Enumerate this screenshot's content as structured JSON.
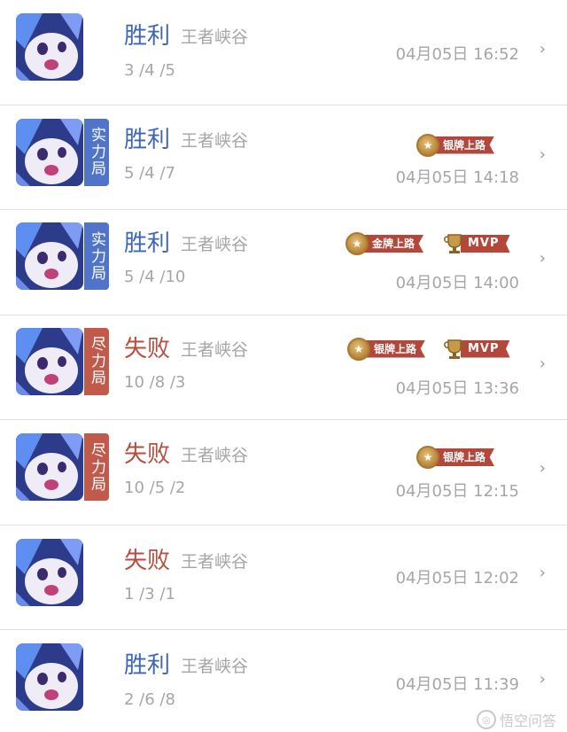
{
  "matches": [
    {
      "result": "胜利",
      "result_type": "win",
      "map": "王者峡谷",
      "kda": "3 /4 /5",
      "time": "04月05日 16:52",
      "mode": "",
      "badges": []
    },
    {
      "result": "胜利",
      "result_type": "win",
      "map": "王者峡谷",
      "kda": "5 /4 /7",
      "time": "04月05日 14:18",
      "mode": "实力局",
      "badges": [
        "银牌上路"
      ]
    },
    {
      "result": "胜利",
      "result_type": "win",
      "map": "王者峡谷",
      "kda": "5 /4 /10",
      "time": "04月05日 14:00",
      "mode": "实力局",
      "badges": [
        "金牌上路",
        "MVP"
      ]
    },
    {
      "result": "失败",
      "result_type": "lose",
      "map": "王者峡谷",
      "kda": "10 /8 /3",
      "time": "04月05日 13:36",
      "mode": "尽力局",
      "badges": [
        "银牌上路",
        "MVP"
      ]
    },
    {
      "result": "失败",
      "result_type": "lose",
      "map": "王者峡谷",
      "kda": "10 /5 /2",
      "time": "04月05日 12:15",
      "mode": "尽力局",
      "badges": [
        "银牌上路"
      ]
    },
    {
      "result": "失败",
      "result_type": "lose",
      "map": "王者峡谷",
      "kda": "1 /3 /1",
      "time": "04月05日 12:02",
      "mode": "",
      "badges": []
    },
    {
      "result": "胜利",
      "result_type": "win",
      "map": "王者峡谷",
      "kda": "2 /6 /8",
      "time": "04月05日 11:39",
      "mode": "",
      "badges": []
    }
  ],
  "watermark": "悟空问答",
  "colors": {
    "win": "#3e66b3",
    "lose": "#b64d3f",
    "mode_blue": "#4f74c9",
    "mode_red": "#c25a4c",
    "ribbon": "#b4463a",
    "muted": "#a6a6a6"
  },
  "icons": {
    "chevron": "chevron-right-icon",
    "medal": "medal-icon",
    "trophy": "trophy-icon",
    "avatar": "hero-avatar-icon"
  }
}
